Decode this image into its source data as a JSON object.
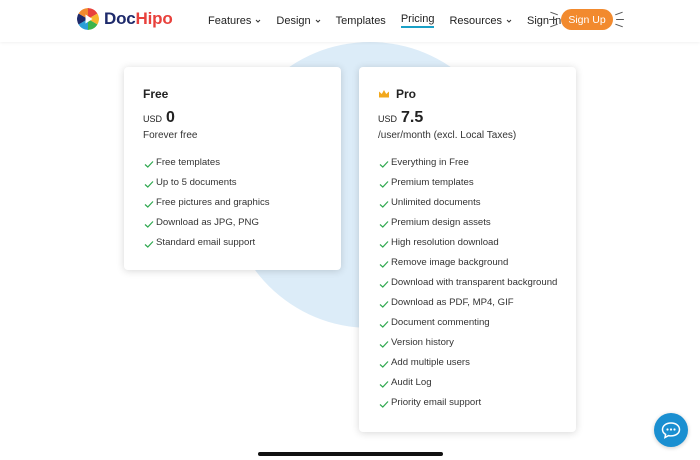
{
  "brand": {
    "name_part1": "Doc",
    "name_part2": "Hipo",
    "doc_color": "#1e2a6b",
    "hipo_color": "#e8413c"
  },
  "nav": {
    "items": [
      {
        "label": "Features",
        "dropdown": true,
        "active": false
      },
      {
        "label": "Design",
        "dropdown": true,
        "active": false
      },
      {
        "label": "Templates",
        "dropdown": false,
        "active": false
      },
      {
        "label": "Pricing",
        "dropdown": false,
        "active": true
      },
      {
        "label": "Resources",
        "dropdown": true,
        "active": false
      }
    ],
    "sign_in": "Sign In",
    "sign_up": "Sign Up",
    "accent_color": "#f28a2e",
    "active_underline_color": "#1aa0c6"
  },
  "plans": [
    {
      "name": "Free",
      "currency": "USD",
      "amount": "0",
      "period": "Forever free",
      "features": [
        "Free templates",
        "Up to 5 documents",
        "Free pictures and graphics",
        "Download as JPG, PNG",
        "Standard email support"
      ]
    },
    {
      "name": "Pro",
      "icon": "crown-icon",
      "currency": "USD",
      "amount": "7.5",
      "period": "/user/month (excl. Local Taxes)",
      "features": [
        "Everything in Free",
        "Premium templates",
        "Unlimited documents",
        "Premium design assets",
        "High resolution download",
        "Remove image background",
        "Download with transparent background",
        "Download as PDF, MP4, GIF",
        "Document commenting",
        "Version history",
        "Add multiple users",
        "Audit Log",
        "Priority email support"
      ]
    }
  ],
  "chat": {
    "icon": "chat-icon",
    "color": "#1a8fd1"
  },
  "check_color": "#2fa84f",
  "background_circle_color": "#dcecf8"
}
